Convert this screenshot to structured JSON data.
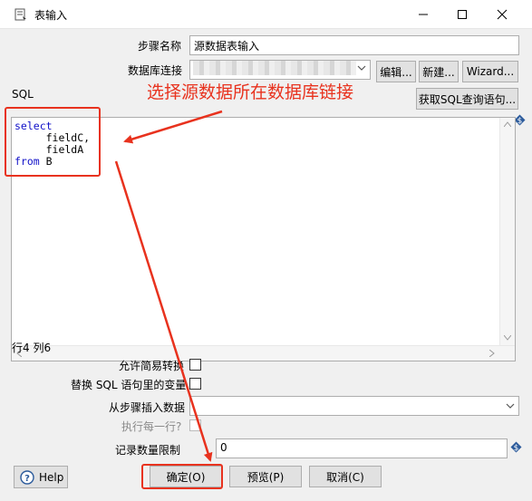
{
  "window": {
    "title": "表输入"
  },
  "form": {
    "step_name_label": "步骤名称",
    "step_name_value": "源数据表输入",
    "db_connection_label": "数据库连接",
    "edit_button": "编辑...",
    "new_button": "新建...",
    "wizard_button": "Wizard...",
    "sql_label": "SQL",
    "get_sql_button": "获取SQL查询语句..."
  },
  "editor": {
    "lines": [
      {
        "kw": "select",
        "rest": ""
      },
      {
        "kw": "",
        "rest": "     fieldC,"
      },
      {
        "kw": "",
        "rest": "     fieldA"
      },
      {
        "kw": "from",
        "rest": " B"
      }
    ]
  },
  "status": {
    "position": "行4 列6"
  },
  "options": {
    "lazy_conversion_label": "允许简易转换",
    "replace_vars_label": "替换 SQL 语句里的变量",
    "insert_from_step_label": "从步骤插入数据",
    "execute_each_row_label": "执行每一行?",
    "limit_label": "记录数量限制",
    "limit_value": "0"
  },
  "buttons": {
    "help": "Help",
    "ok": "确定(O)",
    "preview": "预览(P)",
    "cancel": "取消(C)"
  },
  "annotation": {
    "text": "选择源数据所在数据库链接",
    "color": "#e8321e"
  },
  "icons": {
    "window": "table-input-icon",
    "minimize": "minimize-icon",
    "maximize": "maximize-icon",
    "close": "close-icon",
    "help": "help-icon",
    "variable": "variable-diamond-icon"
  }
}
